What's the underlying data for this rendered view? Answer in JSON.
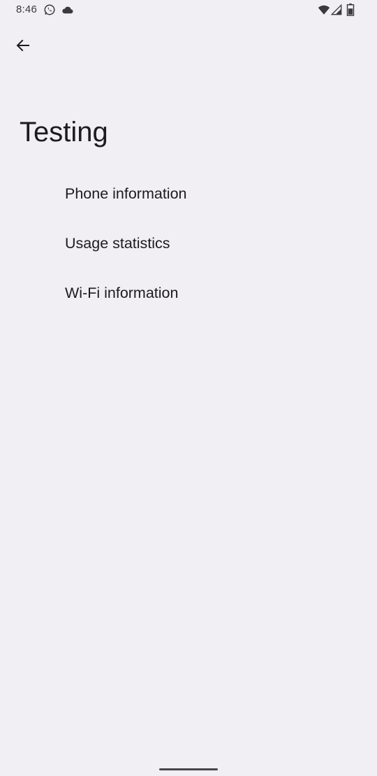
{
  "status_bar": {
    "time": "8:46",
    "icons": [
      "whatsapp-icon",
      "cloud-icon",
      "wifi-icon",
      "signal-icon",
      "battery-icon"
    ]
  },
  "toolbar": {
    "back_icon": "arrow-back-icon"
  },
  "page": {
    "title": "Testing"
  },
  "menu": {
    "items": [
      {
        "label": "Phone information"
      },
      {
        "label": "Usage statistics"
      },
      {
        "label": "Wi-Fi information"
      }
    ]
  },
  "colors": {
    "background": "#f1eff4",
    "text": "#1c1b1f",
    "gesture_bar": "#47464b"
  }
}
